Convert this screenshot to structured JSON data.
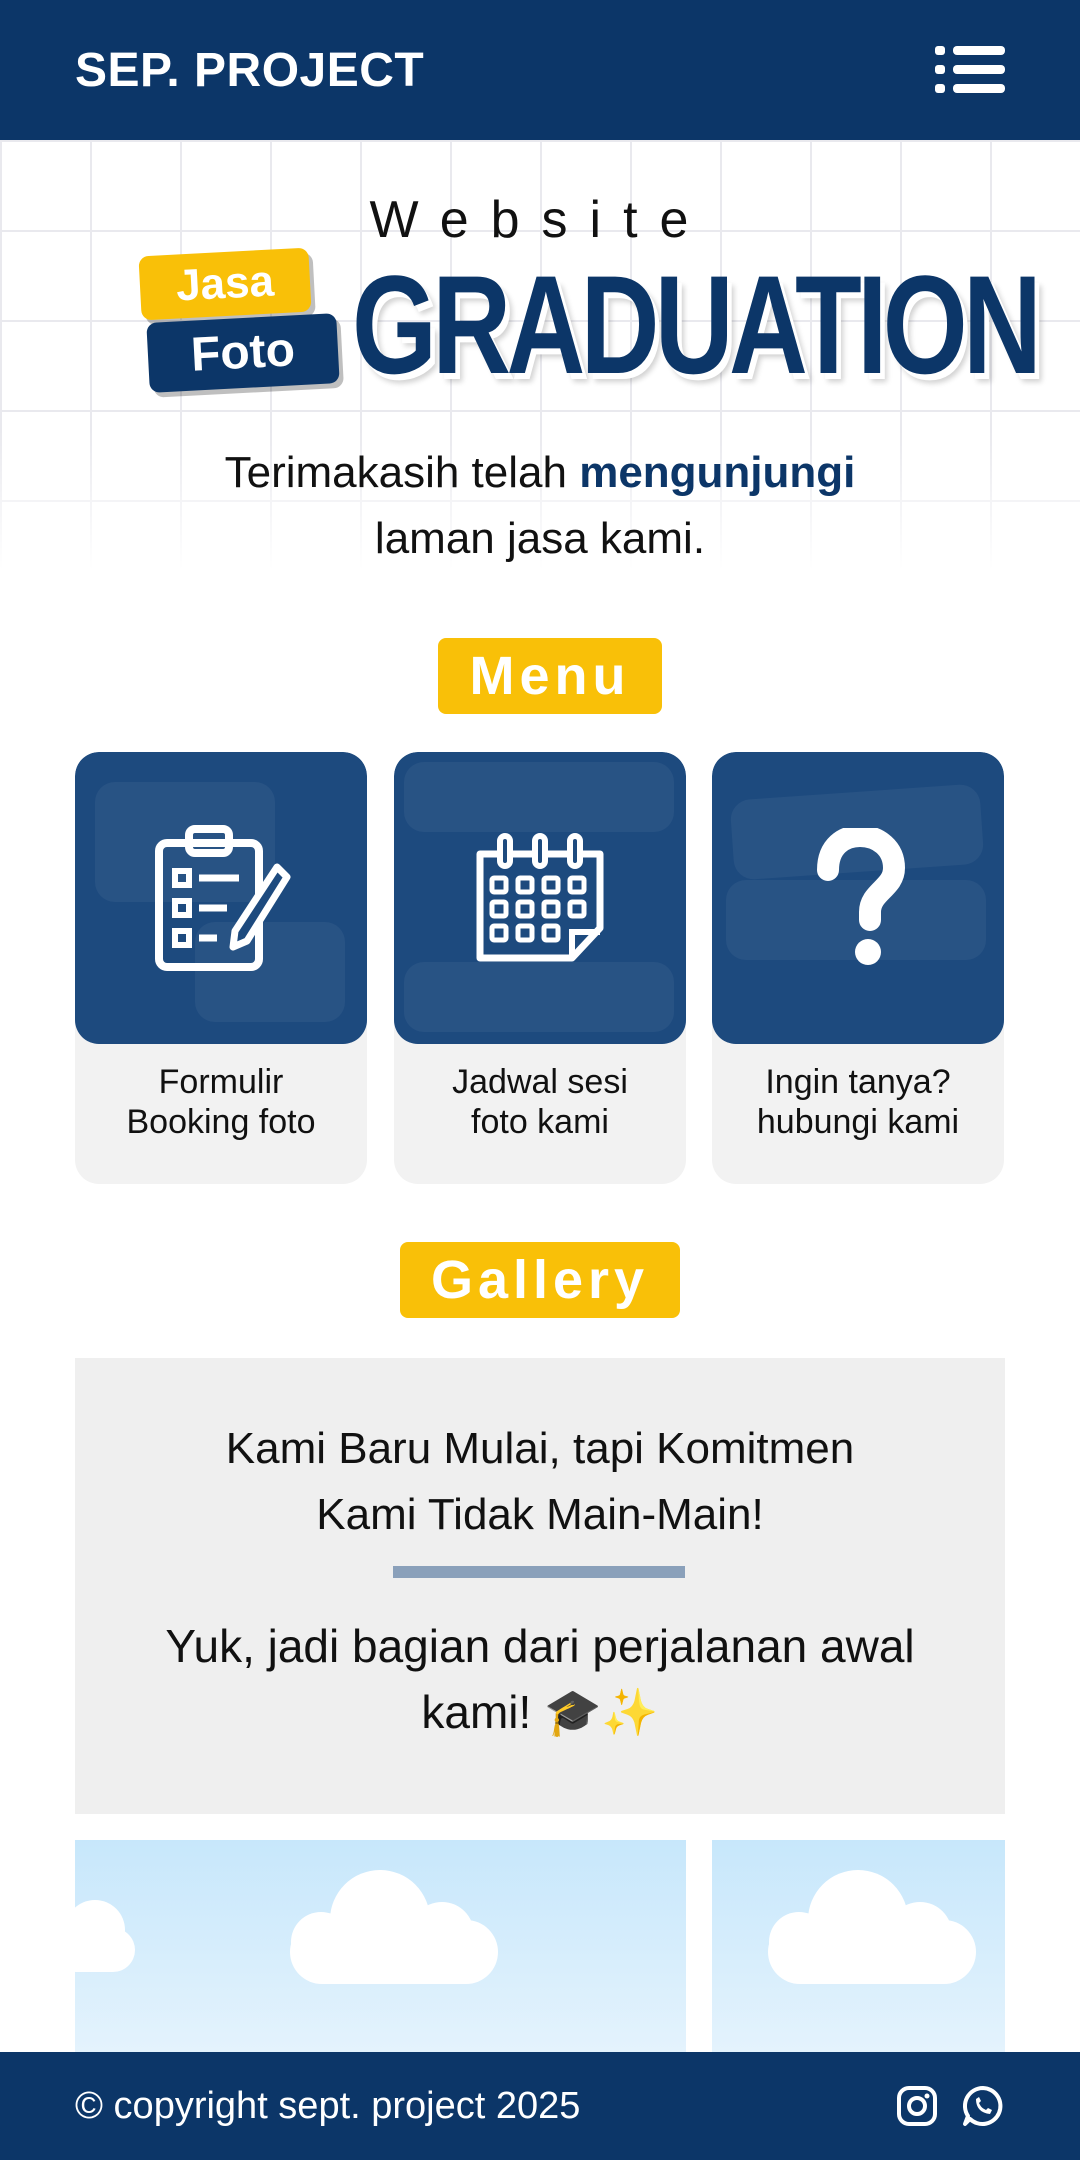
{
  "header": {
    "brand": "SEP. PROJECT",
    "menu_icon": "hamburger-menu-icon"
  },
  "hero": {
    "word": "Website",
    "tag_top": "Jasa",
    "tag_bottom": "Foto",
    "headline": "GRADUATION",
    "thanks_prefix": "Terimakasih telah",
    "thanks_highlight": "mengunjungi",
    "thanks_suffix": "laman jasa kami."
  },
  "menu": {
    "label": "Menu",
    "items": [
      {
        "line1": "Formulir",
        "line2": "Booking foto",
        "icon": "clipboard-form-icon"
      },
      {
        "line1": "Jadwal sesi",
        "line2": "foto kami",
        "icon": "calendar-icon"
      },
      {
        "line1": "Ingin tanya?",
        "line2": "hubungi kami",
        "icon": "question-mark-icon"
      }
    ]
  },
  "gallery": {
    "label": "Gallery",
    "title_line1": "Kami Baru Mulai, tapi Komitmen",
    "title_line2": "Kami Tidak Main-Main!",
    "sub_line1": "Yuk, jadi bagian dari perjalanan awal",
    "sub_line2": "kami! 🎓✨"
  },
  "footer": {
    "copyright": "© copyright sept. project 2025",
    "icons": [
      "instagram-icon",
      "whatsapp-icon"
    ]
  },
  "colors": {
    "navy": "#0c3668",
    "yellow": "#f9c008",
    "card_bg": "#f2f2f2"
  }
}
